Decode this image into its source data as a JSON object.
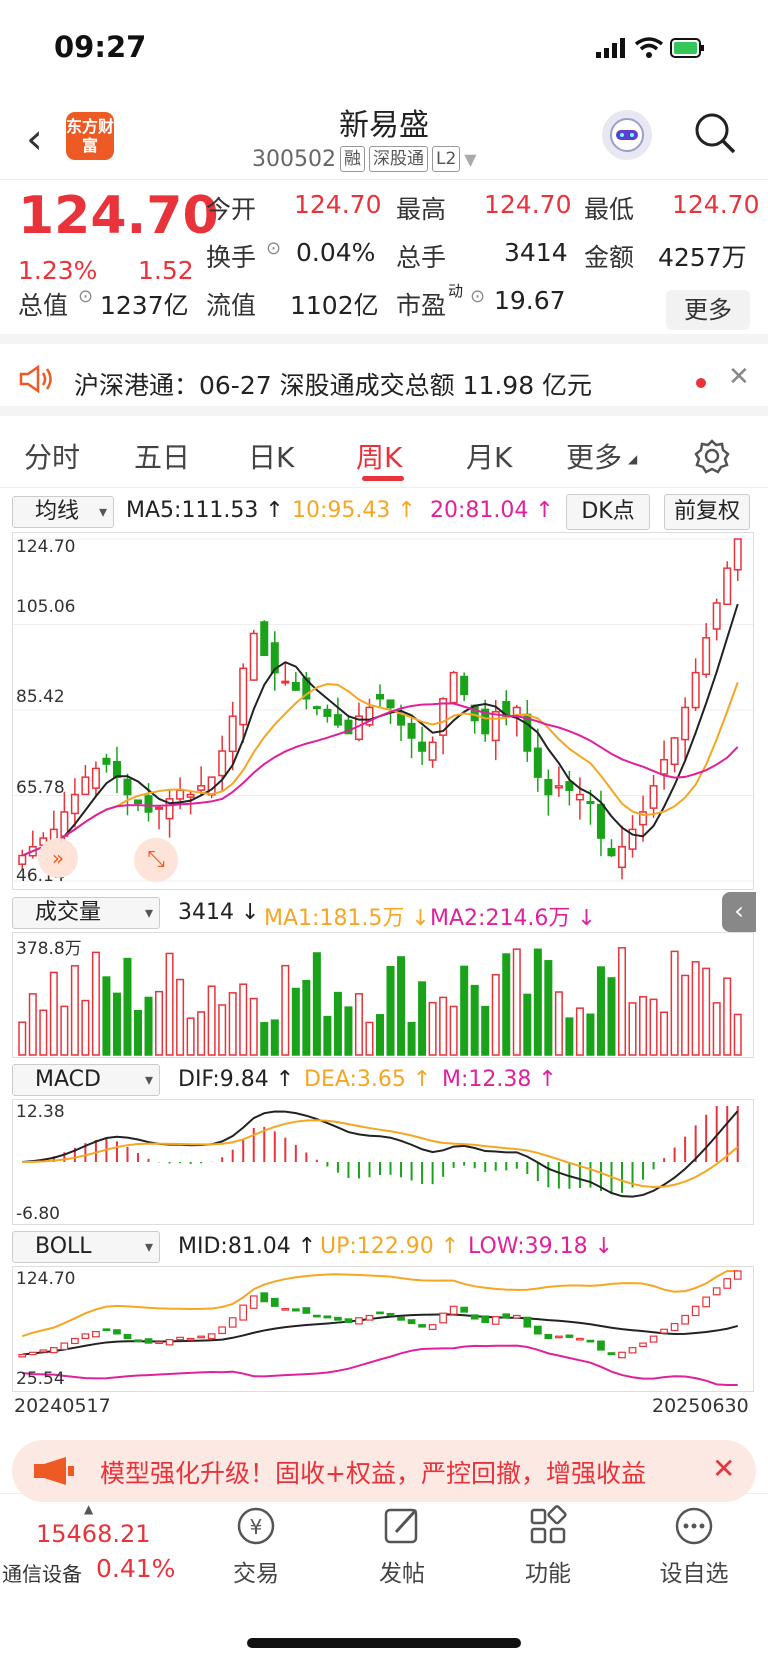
{
  "status_bar": {
    "time": "09:27"
  },
  "header": {
    "title": "新易盛",
    "code": "300502",
    "tags": [
      "融",
      "深股通",
      "L2"
    ],
    "logo_text": "东方财富"
  },
  "quote": {
    "price": "124.70",
    "change_pct": "1.23%",
    "change": "1.52",
    "fields": {
      "open_label": "今开",
      "open": "124.70",
      "high_label": "最高",
      "high": "124.70",
      "low_label": "最低",
      "low": "124.70",
      "turnover_label": "换手",
      "turnover": "0.04%",
      "volume_label": "总手",
      "volume": "3414",
      "amount_label": "金额",
      "amount": "4257万",
      "mktcap_label": "总值",
      "mktcap": "1237亿",
      "float_label": "流值",
      "float": "1102亿",
      "pe_label": "市盈",
      "pe_sup": "动",
      "pe": "19.67"
    },
    "more": "更多"
  },
  "notice": {
    "text": "沪深港通：06-27 深股通成交总额 11.98 亿元"
  },
  "tabs": [
    "分时",
    "五日",
    "日K",
    "周K",
    "月K",
    "更多"
  ],
  "active_tab": "周K",
  "main_chart": {
    "selector": "均线",
    "ma5": "MA5:111.53 ↑",
    "ma10": "10:95.43 ↑",
    "ma20": "20:81.04 ↑",
    "dk": "DK点",
    "adjust": "前复权",
    "y_labels": [
      "124.70",
      "105.06",
      "85.42",
      "65.78",
      "46.14"
    ]
  },
  "volume_chart": {
    "selector": "成交量",
    "vol": "3414 ↓",
    "ma1": "MA1:181.5万 ↓",
    "ma2": "MA2:214.6万 ↓",
    "y_top": "378.8万"
  },
  "macd_chart": {
    "selector": "MACD",
    "dif": "DIF:9.84 ↑",
    "dea": "DEA:3.65 ↑",
    "m": "M:12.38 ↑",
    "y_top": "12.38",
    "y_bottom": "-6.80"
  },
  "boll_chart": {
    "selector": "BOLL",
    "mid": "MID:81.04 ↑",
    "up": "UP:122.90 ↑",
    "low": "LOW:39.18 ↓",
    "y_top": "124.70",
    "y_bottom": "25.54"
  },
  "date_range": {
    "start": "20240517",
    "end": "20250630"
  },
  "promo": {
    "text": "模型强化升级！固收+权益，严控回撤，增强收益"
  },
  "bottom_bar": {
    "index_value": "15468.21",
    "index_name": "通信设备",
    "index_change": "0.41%",
    "items": [
      "交易",
      "发帖",
      "功能",
      "设自选"
    ]
  },
  "colors": {
    "up": "#e8333a",
    "down": "#1aa31a",
    "ma10": "#f5a623",
    "ma20": "#e0209c",
    "ma5": "#222222"
  },
  "chart_data": {
    "type": "candlestick",
    "closes": [
      52,
      54,
      56,
      58,
      62,
      66,
      70,
      72,
      73,
      70,
      66,
      64,
      62,
      63,
      65,
      67,
      66,
      68,
      70,
      76,
      84,
      95,
      103,
      98,
      94,
      92,
      90,
      88,
      86,
      84,
      82,
      80,
      84,
      86,
      88,
      86,
      82,
      79,
      76,
      78,
      88,
      94,
      89,
      83,
      80,
      85,
      84,
      86,
      76,
      70,
      66,
      68,
      67,
      66,
      64,
      56,
      52,
      54,
      58,
      62,
      68,
      74,
      79,
      86,
      94,
      102,
      110,
      118,
      124.7
    ],
    "ylim": [
      46.14,
      124.7
    ]
  }
}
